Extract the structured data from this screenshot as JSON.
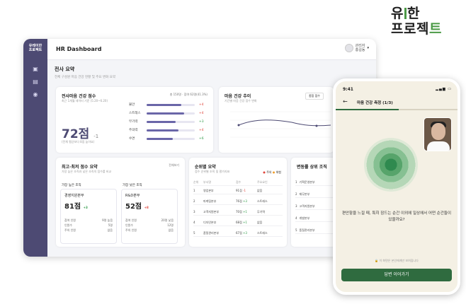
{
  "logo": {
    "line1a": "유",
    "line1b": "한",
    "line2a": "프로젝",
    "line2b": "트"
  },
  "sidebar": {
    "brand1": "유레이한",
    "brand2": "프로젝트"
  },
  "header": {
    "title": "HR Dashboard",
    "role": "관리자",
    "name": "홍길동"
  },
  "summary": {
    "title": "전사 요약",
    "subtitle": "전체 구성원 마음 건강 현황 및 주요 변화 요약"
  },
  "health": {
    "title": "전사마음 건강 점수",
    "subtitle": "최근 1개월 데이터 기준 (5.20~6.20)",
    "meta": "총 150명 · 참여 62명(41.3%)",
    "score": "72점",
    "delta": "-1",
    "note": "(전체 평균보다 8점 높아요)",
    "items": [
      {
        "label": "불안",
        "fill": 0.72,
        "delta": "+4",
        "dir": "red"
      },
      {
        "label": "스트레스",
        "fill": 0.78,
        "delta": "+4",
        "dir": "red"
      },
      {
        "label": "무기력",
        "fill": 0.6,
        "delta": "+3",
        "dir": "green"
      },
      {
        "label": "주의력",
        "fill": 0.66,
        "delta": "+4",
        "dir": "red"
      },
      {
        "label": "수면",
        "fill": 0.55,
        "delta": "+6",
        "dir": "green"
      }
    ]
  },
  "trend": {
    "title": "마음 건강 추이",
    "subtitle": "기간별 마음 건강 점수 변화",
    "select": "종합 점수"
  },
  "compare": {
    "title": "최고·최저 점수 요약",
    "subtitle": "가장 높은 조직과 낮은 조직의 점수를 비교",
    "more": "전체보기",
    "high": {
      "label": "가장 높은 조직",
      "org": "경영지원본부",
      "score": "81점",
      "delta": "+3",
      "r1": "참여 인원",
      "v1": "9명 높음",
      "r2": "인원수",
      "v2": "5명",
      "r3": "주의 인원",
      "v3": "없음"
    },
    "low": {
      "label": "가장 낮은 조직",
      "org": "R&D본부",
      "score": "52점",
      "delta": "+8",
      "r1": "참여 인원",
      "v1": "20명 낮음",
      "r2": "인원수",
      "v2": "12명",
      "r3": "주의 인원",
      "v3": "없음"
    }
  },
  "ranking": {
    "title": "순위별 요약",
    "subtitle": "점수 순위별 조직 및 평가지표",
    "leg1": "주의",
    "leg2": "위험",
    "cols": [
      "순위",
      "부서명",
      "점수",
      "주요요인"
    ],
    "rows": [
      {
        "rank": "1",
        "dept": "영업본부",
        "score": "91점",
        "delta": "-1",
        "factor": "없음"
      },
      {
        "rank": "2",
        "dept": "마케팅본부",
        "score": "76점",
        "delta": "+3",
        "factor": "스트레스"
      },
      {
        "rank": "3",
        "dept": "고객지원본부",
        "score": "70점",
        "delta": "+1",
        "factor": "무기력"
      },
      {
        "rank": "4",
        "dept": "디자인본부",
        "score": "68점",
        "delta": "+1",
        "factor": "없음"
      },
      {
        "rank": "5",
        "dept": "품질관리본부",
        "score": "67점",
        "delta": "+3",
        "factor": "스트레스"
      }
    ]
  },
  "changes": {
    "title": "변동률 상위 조직",
    "rows": [
      "기획운영본부",
      "재무본부",
      "고객지원본부",
      "개발본부",
      "품질관리본부"
    ]
  },
  "phone": {
    "time": "9:41",
    "title": "마음 건강 측정 (1/3)",
    "question": "편안함을 느낄 때, 특히 잠드는 순간 이외에 일상에서 어떤 순간들이 있을까요?",
    "note": "이 화면은 본인에게만 보여집니다",
    "button": "답변 이어가기"
  }
}
